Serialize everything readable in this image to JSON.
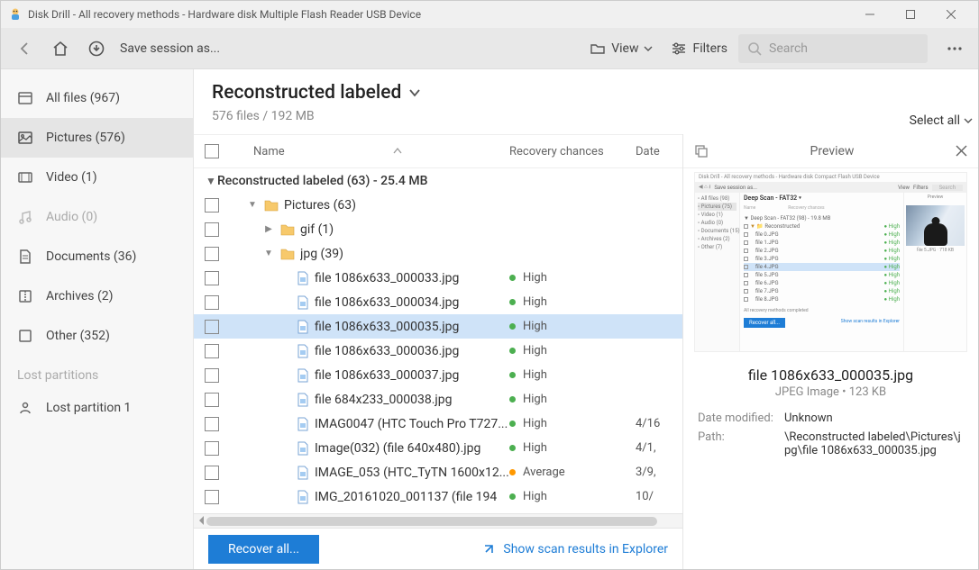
{
  "window": {
    "title": "Disk Drill - All recovery methods - Hardware disk Multiple Flash Reader USB Device"
  },
  "toolbar": {
    "save_session": "Save session as...",
    "view": "View",
    "filters": "Filters",
    "search_placeholder": "Search"
  },
  "sidebar": {
    "items": [
      {
        "label": "All files (967)",
        "icon": "allfiles"
      },
      {
        "label": "Pictures (576)",
        "icon": "pictures"
      },
      {
        "label": "Video (1)",
        "icon": "video"
      },
      {
        "label": "Audio (0)",
        "icon": "audio"
      },
      {
        "label": "Documents (36)",
        "icon": "documents"
      },
      {
        "label": "Archives (2)",
        "icon": "archives"
      },
      {
        "label": "Other (352)",
        "icon": "other"
      }
    ],
    "lost_header": "Lost partitions",
    "lost_items": [
      {
        "label": "Lost partition 1"
      }
    ]
  },
  "content": {
    "title": "Reconstructed labeled",
    "subtitle": "576 files / 192 MB",
    "select_all": "Select all",
    "columns": {
      "name": "Name",
      "recovery": "Recovery chances",
      "date": "Date"
    },
    "group_row": "Reconstructed labeled (63) - 25.4 MB",
    "folders": {
      "pictures": "Pictures (63)",
      "gif": "gif (1)",
      "jpg": "jpg (39)"
    },
    "files": [
      {
        "name": "file 1086x633_000033.jpg",
        "rec": "High",
        "date": ""
      },
      {
        "name": "file 1086x633_000034.jpg",
        "rec": "High",
        "date": ""
      },
      {
        "name": "file 1086x633_000035.jpg",
        "rec": "High",
        "date": ""
      },
      {
        "name": "file 1086x633_000036.jpg",
        "rec": "High",
        "date": ""
      },
      {
        "name": "file 1086x633_000037.jpg",
        "rec": "High",
        "date": ""
      },
      {
        "name": "file 684x233_000038.jpg",
        "rec": "High",
        "date": ""
      },
      {
        "name": "IMAG0047 (HTC Touch Pro T727...",
        "rec": "High",
        "date": "4/16"
      },
      {
        "name": "Image(032) (file 640x480).jpg",
        "rec": "High",
        "date": "4/1,"
      },
      {
        "name": "IMAGE_053 (HTC_TyTN 1600x12...",
        "rec": "Average",
        "date": "3/9,"
      },
      {
        "name": "IMG_20161020_001137 (file 194",
        "rec": "High",
        "date": "10/"
      }
    ]
  },
  "footer": {
    "recover": "Recover all...",
    "explorer": "Show scan results in Explorer"
  },
  "preview": {
    "title": "Preview",
    "filename": "file 1086x633_000035.jpg",
    "filetype": "JPEG Image • 123 KB",
    "meta": {
      "date_k": "Date modified:",
      "date_v": "Unknown",
      "path_k": "Path:",
      "path_v": "\\Reconstructed labeled\\Pictures\\jpg\\file 1086x633_000035.jpg"
    },
    "mini": {
      "titlebar": "Disk Drill - All recovery methods - Hardware disk Compact Flash USB Device",
      "save": "Save session as...",
      "view": "View",
      "filters": "Filters",
      "search": "Search",
      "side": [
        "All files (98)",
        "Pictures (75)",
        "Video (1)",
        "Audio (0)",
        "Documents (15)",
        "Archives (2)",
        "Other (7)"
      ],
      "head": "Deep Scan - FAT32",
      "group": "Deep Scan - FAT32 (98) - 19.8 MB",
      "rows": [
        "Reconstructed",
        "file 0.JPG",
        "file 1.JPG",
        "file 2.JPG",
        "file 3.JPG",
        "file 4.JPG",
        "file 5.JPG",
        "file 6.JPG",
        "file 7.JPG",
        "file 8.JPG"
      ],
      "btn": "Recover all...",
      "link": "Show scan results in Explorer",
      "right_title": "Preview",
      "right_file": "file 5.JPG · 718 KB"
    }
  }
}
